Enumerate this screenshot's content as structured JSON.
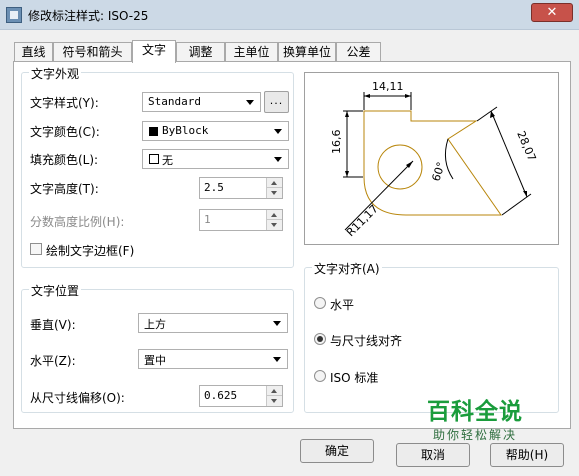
{
  "window": {
    "title": "修改标注样式: ISO-25",
    "close_glyph": "✕"
  },
  "tabs": [
    {
      "label": "直线"
    },
    {
      "label": "符号和箭头"
    },
    {
      "label": "文字",
      "active": true
    },
    {
      "label": "调整"
    },
    {
      "label": "主单位"
    },
    {
      "label": "换算单位"
    },
    {
      "label": "公差"
    }
  ],
  "text_appearance": {
    "title": "文字外观",
    "style_label": "文字样式(Y):",
    "style_value": "Standard",
    "style_browse": "...",
    "color_label": "文字颜色(C):",
    "color_value": "ByBlock",
    "fill_label": "填充颜色(L):",
    "fill_value": "无",
    "height_label": "文字高度(T):",
    "height_value": "2.5",
    "fraction_label": "分数高度比例(H):",
    "fraction_value": "1",
    "frame_label": "绘制文字边框(F)"
  },
  "text_placement": {
    "title": "文字位置",
    "vertical_label": "垂直(V):",
    "vertical_value": "上方",
    "horizontal_label": "水平(Z):",
    "horizontal_value": "置中",
    "offset_label": "从尺寸线偏移(O):",
    "offset_value": "0.625"
  },
  "text_alignment": {
    "title": "文字对齐(A)",
    "options": [
      {
        "label": "水平",
        "checked": false
      },
      {
        "label": "与尺寸线对齐",
        "checked": true
      },
      {
        "label": "ISO 标准",
        "checked": false
      }
    ]
  },
  "preview": {
    "dim_top": "14,11",
    "dim_left": "16,6",
    "dim_right": "28,07",
    "dim_angle": "60°",
    "dim_radius": "R11,17",
    "line_color": "#b8860b"
  },
  "buttons": {
    "ok": "确定",
    "cancel": "取消",
    "help": "帮助(H)"
  },
  "watermark": {
    "title": "百科全说",
    "subtitle": "助你轻松解决"
  }
}
